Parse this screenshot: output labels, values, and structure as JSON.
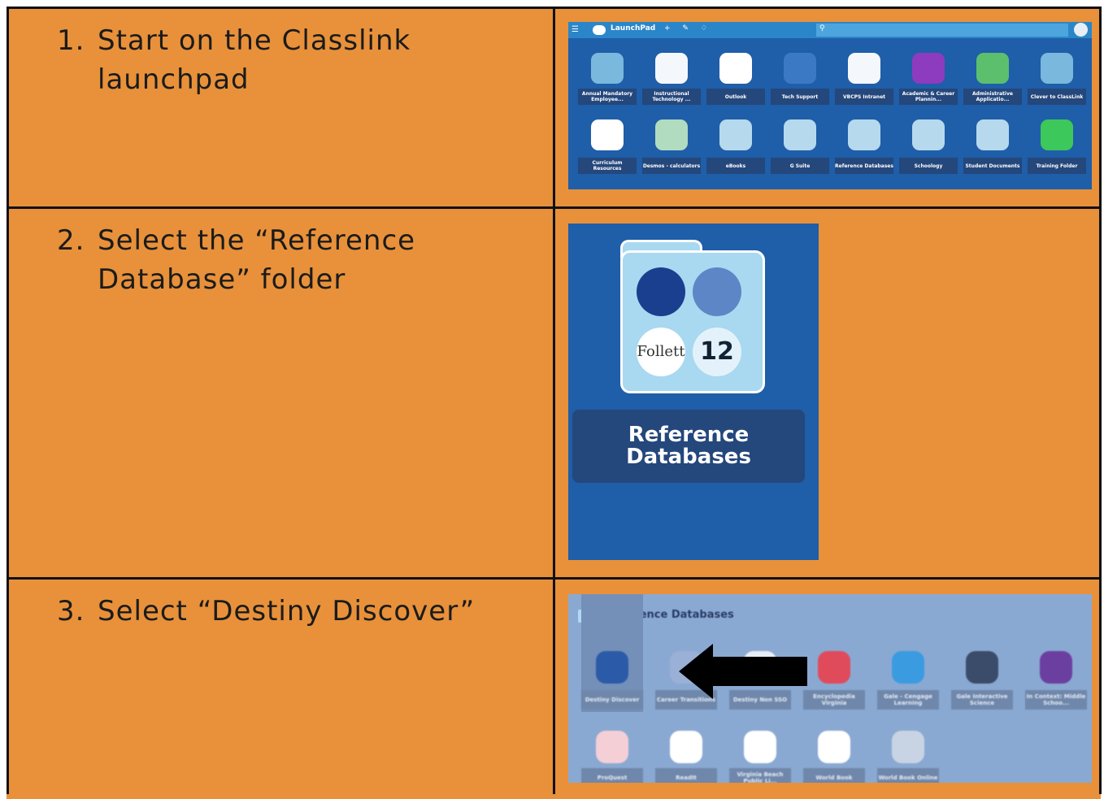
{
  "steps": [
    {
      "num": "1.",
      "text": "Start on the Classlink launchpad"
    },
    {
      "num": "2.",
      "text": "Select the “Reference Database” folder"
    },
    {
      "num": "3.",
      "text": "Select “Destiny Discover”"
    }
  ],
  "launchpad": {
    "brand": "LaunchPad",
    "tiles_row1": [
      {
        "label": "Annual Mandatory Employee...",
        "color": "#7ab8dd"
      },
      {
        "label": "Instructional Technology ...",
        "color": "#f4f7fb"
      },
      {
        "label": "Outlook",
        "color": "#ffffff"
      },
      {
        "label": "Tech Support",
        "color": "#3b79c5"
      },
      {
        "label": "VBCPS Intranet",
        "color": "#f4f7fb"
      },
      {
        "label": "Academic & Career Plannin...",
        "color": "#8d3bbf"
      },
      {
        "label": "Administrative Applicatio...",
        "color": "#5cbf6e"
      },
      {
        "label": "Clever to ClassLink",
        "color": "#7ab8dd"
      }
    ],
    "tiles_row2": [
      {
        "label": "Curriculum Resources",
        "color": "#ffffff"
      },
      {
        "label": "Desmos - calculators",
        "color": "#b2dcc0"
      },
      {
        "label": "eBooks",
        "color": "#b7d9ee"
      },
      {
        "label": "G Suite",
        "color": "#b7d9ee"
      },
      {
        "label": "Reference Databases",
        "color": "#b7d9ee"
      },
      {
        "label": "Schoology",
        "color": "#b7d9ee"
      },
      {
        "label": "Student Documents",
        "color": "#b7d9ee"
      },
      {
        "label": "Training Folder",
        "color": "#3cc85a"
      }
    ]
  },
  "folder": {
    "label": "Reference Databases",
    "count": "12",
    "follett": "Follett"
  },
  "ref_db": {
    "title": "Reference Databases",
    "row1": [
      {
        "label": "Destiny Discover",
        "color": "#2a5aa8"
      },
      {
        "label": "Career Transitions",
        "color": "#9bb0d6"
      },
      {
        "label": "Destiny Non SSO",
        "color": "#e8eef7"
      },
      {
        "label": "Encyclopedia Virginia",
        "color": "#e04b5c"
      },
      {
        "label": "Gale - Cengage Learning",
        "color": "#3a9be0"
      },
      {
        "label": "Gale Interactive Science",
        "color": "#3b4c6b"
      },
      {
        "label": "In Context: Middle Schoo...",
        "color": "#6b3fa0"
      }
    ],
    "row2": [
      {
        "label": "ProQuest",
        "color": "#f4d0d6"
      },
      {
        "label": "ReadIt",
        "color": "#ffffff"
      },
      {
        "label": "Virginia Beach Public Li...",
        "color": "#ffffff"
      },
      {
        "label": "World Book",
        "color": "#ffffff"
      },
      {
        "label": "World Book Online",
        "color": "#c8d4e4"
      }
    ]
  }
}
